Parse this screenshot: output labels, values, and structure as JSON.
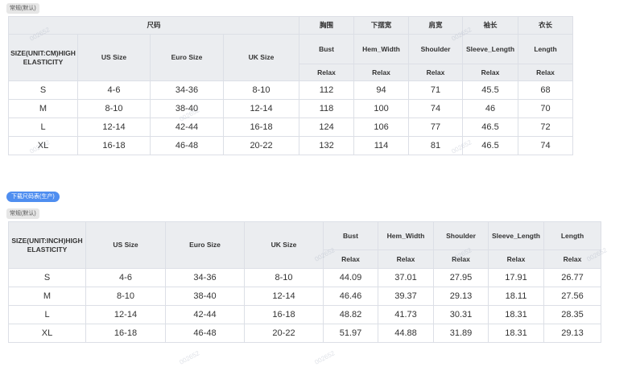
{
  "section1": {
    "tag": "常规(默认)",
    "group_size_header": "尺码",
    "size_column_header": "SIZE(UNIT:CM)HIGH ELASTICITY",
    "size_systems": [
      "US Size",
      "Euro Size",
      "UK Size"
    ],
    "measure_columns": [
      {
        "cn": "胸围",
        "en": "Bust",
        "fit": "Relax"
      },
      {
        "cn": "下摆宽",
        "en": "Hem_Width",
        "fit": "Relax"
      },
      {
        "cn": "肩宽",
        "en": "Shoulder",
        "fit": "Relax"
      },
      {
        "cn": "袖长",
        "en": "Sleeve_Length",
        "fit": "Relax"
      },
      {
        "cn": "衣长",
        "en": "Length",
        "fit": "Relax"
      }
    ],
    "rows": [
      {
        "size": "S",
        "us": "4-6",
        "euro": "34-36",
        "uk": "8-10",
        "bust": "112",
        "hem": "94",
        "shoulder": "71",
        "sleeve": "45.5",
        "length": "68"
      },
      {
        "size": "M",
        "us": "8-10",
        "euro": "38-40",
        "uk": "12-14",
        "bust": "118",
        "hem": "100",
        "shoulder": "74",
        "sleeve": "46",
        "length": "70"
      },
      {
        "size": "L",
        "us": "12-14",
        "euro": "42-44",
        "uk": "16-18",
        "bust": "124",
        "hem": "106",
        "shoulder": "77",
        "sleeve": "46.5",
        "length": "72"
      },
      {
        "size": "XL",
        "us": "16-18",
        "euro": "46-48",
        "uk": "20-22",
        "bust": "132",
        "hem": "114",
        "shoulder": "81",
        "sleeve": "46.5",
        "length": "74"
      }
    ]
  },
  "download_button": "下载尺码表(生产)",
  "section2": {
    "tag": "常规(默认)",
    "size_column_header": "SIZE(UNIT:INCH)HIGH ELASTICITY",
    "size_systems": [
      "US Size",
      "Euro Size",
      "UK Size"
    ],
    "measure_columns": [
      {
        "en": "Bust",
        "fit": "Relax"
      },
      {
        "en": "Hem_Width",
        "fit": "Relax"
      },
      {
        "en": "Shoulder",
        "fit": "Relax"
      },
      {
        "en": "Sleeve_Length",
        "fit": "Relax"
      },
      {
        "en": "Length",
        "fit": "Relax"
      }
    ],
    "rows": [
      {
        "size": "S",
        "us": "4-6",
        "euro": "34-36",
        "uk": "8-10",
        "bust": "44.09",
        "hem": "37.01",
        "shoulder": "27.95",
        "sleeve": "17.91",
        "length": "26.77"
      },
      {
        "size": "M",
        "us": "8-10",
        "euro": "38-40",
        "uk": "12-14",
        "bust": "46.46",
        "hem": "39.37",
        "shoulder": "29.13",
        "sleeve": "18.11",
        "length": "27.56"
      },
      {
        "size": "L",
        "us": "12-14",
        "euro": "42-44",
        "uk": "16-18",
        "bust": "48.82",
        "hem": "41.73",
        "shoulder": "30.31",
        "sleeve": "18.31",
        "length": "28.35"
      },
      {
        "size": "XL",
        "us": "16-18",
        "euro": "46-48",
        "uk": "20-22",
        "bust": "51.97",
        "hem": "44.88",
        "shoulder": "31.89",
        "sleeve": "18.31",
        "length": "29.13"
      }
    ]
  },
  "watermark_text": "002652"
}
